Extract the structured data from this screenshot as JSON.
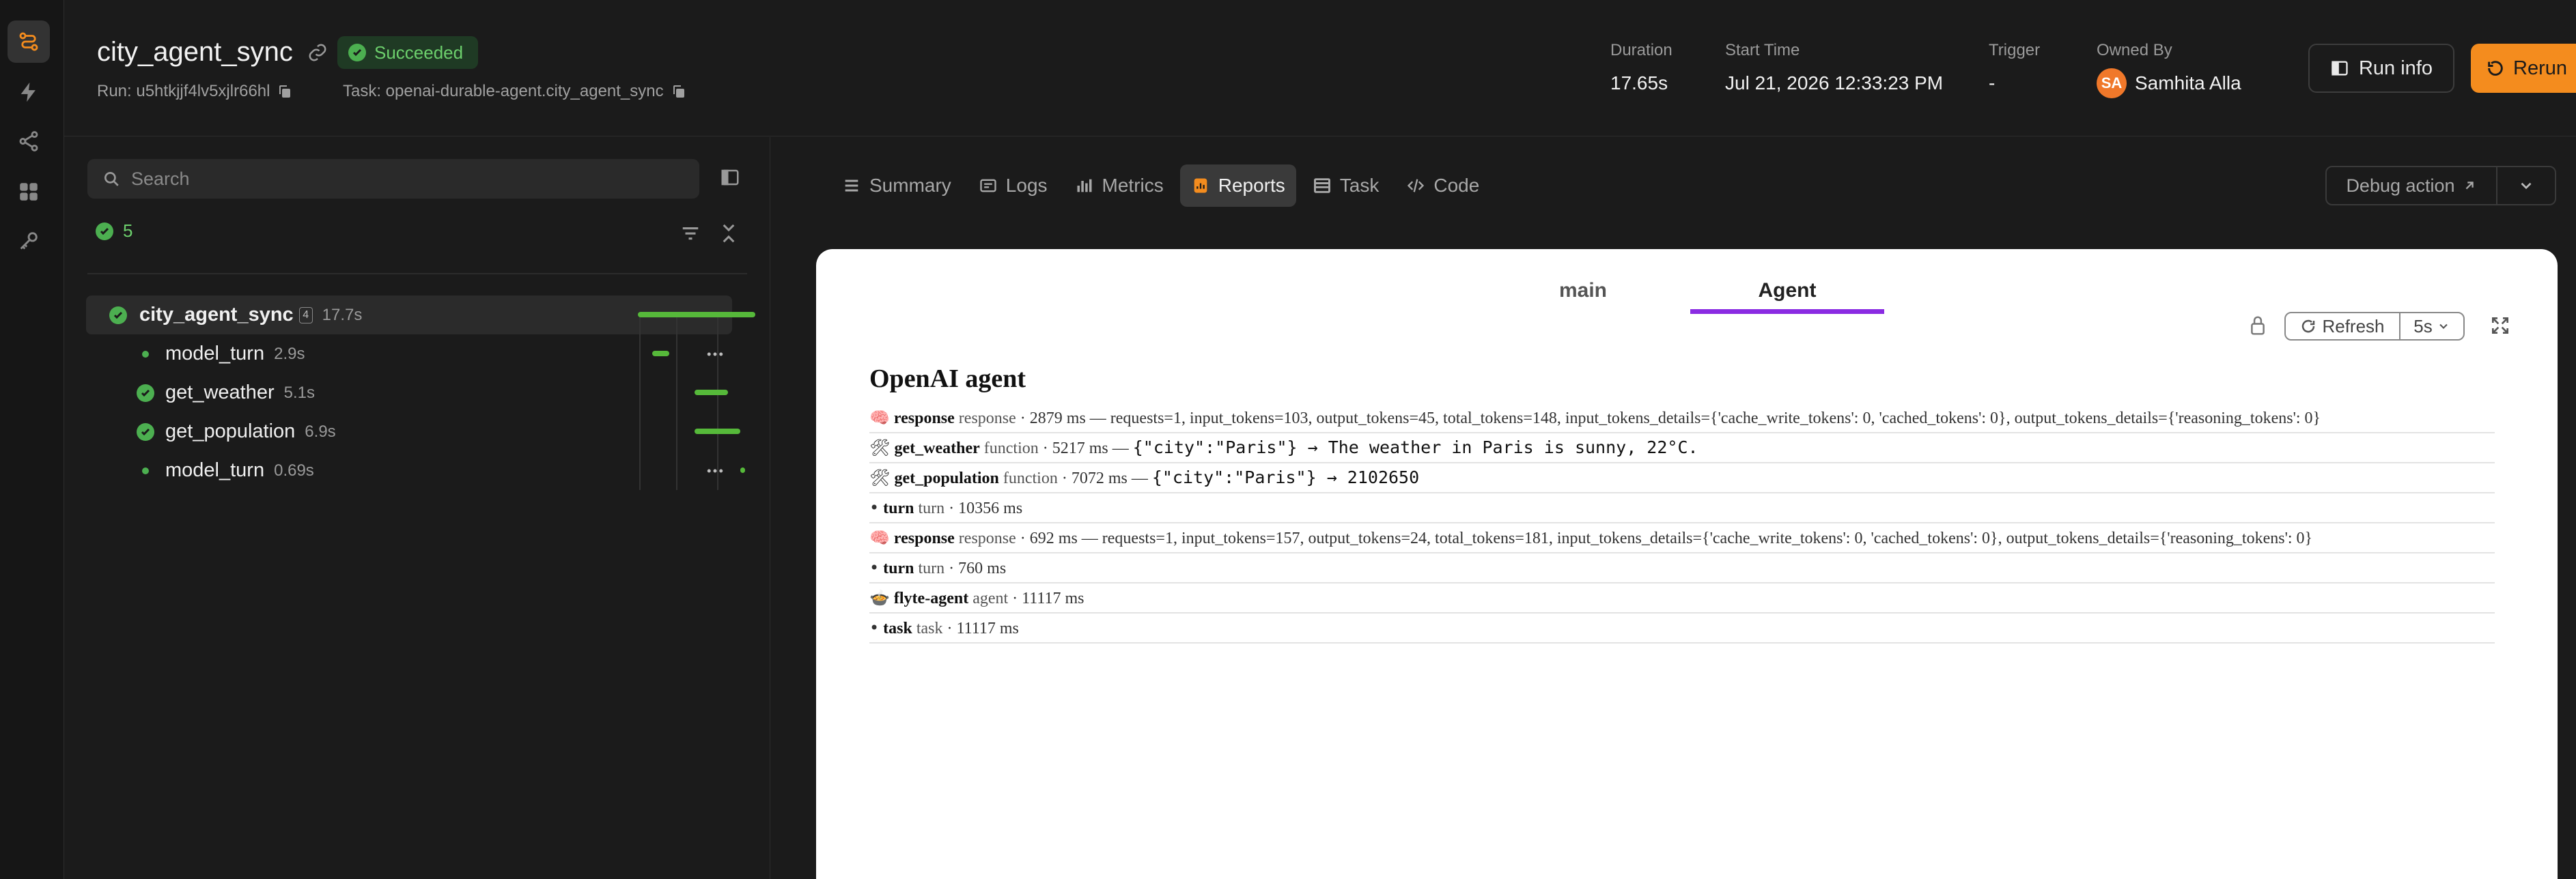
{
  "run": {
    "title": "city_agent_sync",
    "status": "Succeeded",
    "run_label": "Run: u5htkjjf4lv5xjlr66hl",
    "task_label": "Task: openai-durable-agent.city_agent_sync"
  },
  "meta": {
    "duration_label": "Duration",
    "duration_value": "17.65s",
    "start_label": "Start Time",
    "start_value": "Jul 21, 2026 12:33:23 PM",
    "trigger_label": "Trigger",
    "trigger_value": "-",
    "owner_label": "Owned By",
    "owner_initials": "SA",
    "owner_name": "Samhita Alla"
  },
  "header_buttons": {
    "run_info": "Run info",
    "rerun": "Rerun"
  },
  "left": {
    "search_placeholder": "Search",
    "success_count": "5",
    "tree": [
      {
        "name": "city_agent_sync",
        "badge": "4",
        "duration": "17.7s",
        "bar_start": 0.0,
        "bar_end": 1.0
      },
      {
        "name": "model_turn",
        "duration": "2.9s",
        "bar_start": 0.12,
        "bar_end": 0.27
      },
      {
        "name": "get_weather",
        "duration": "5.1s",
        "bar_start": 0.48,
        "bar_end": 0.77
      },
      {
        "name": "get_population",
        "duration": "6.9s",
        "bar_start": 0.48,
        "bar_end": 0.87
      },
      {
        "name": "model_turn",
        "duration": "0.69s",
        "bar_start": 0.87,
        "bar_end": 0.91
      }
    ]
  },
  "tabs": [
    {
      "label": "Summary",
      "icon": "summary-icon"
    },
    {
      "label": "Logs",
      "icon": "logs-icon"
    },
    {
      "label": "Metrics",
      "icon": "metrics-icon"
    },
    {
      "label": "Reports",
      "icon": "reports-icon"
    },
    {
      "label": "Task",
      "icon": "task-icon"
    },
    {
      "label": "Code",
      "icon": "code-icon"
    }
  ],
  "debug_action": "Debug action",
  "report": {
    "tabs": [
      "main",
      "Agent"
    ],
    "refresh": "Refresh",
    "interval": "5s",
    "title": "OpenAI agent",
    "lines": [
      {
        "emoji": "🧠",
        "name": "response",
        "kind": "response",
        "rest": " · 2879 ms — requests=1, input_tokens=103, output_tokens=45, total_tokens=148, input_tokens_details={'cache_write_tokens': 0, 'cached_tokens': 0}, output_tokens_details={'reasoning_tokens': 0}",
        "io": ""
      },
      {
        "emoji": "🛠",
        "name": "get_weather",
        "kind": "function",
        "rest": " · 5217 ms — ",
        "io": "{\"city\":\"Paris\"} → The weather in Paris is sunny, 22°C."
      },
      {
        "emoji": "🛠",
        "name": "get_population",
        "kind": "function",
        "rest": " · 7072 ms — ",
        "io": "{\"city\":\"Paris\"} → 2102650"
      },
      {
        "emoji": "•",
        "name": "turn",
        "kind": "turn",
        "rest": " · 10356 ms",
        "io": ""
      },
      {
        "emoji": "🧠",
        "name": "response",
        "kind": "response",
        "rest": " · 692 ms — requests=1, input_tokens=157, output_tokens=24, total_tokens=181, input_tokens_details={'cache_write_tokens': 0, 'cached_tokens': 0}, output_tokens_details={'reasoning_tokens': 0}",
        "io": ""
      },
      {
        "emoji": "•",
        "name": "turn",
        "kind": "turn",
        "rest": " · 760 ms",
        "io": ""
      },
      {
        "emoji": "🍲",
        "name": "flyte-agent",
        "kind": "agent",
        "rest": " · 11117 ms",
        "io": ""
      },
      {
        "emoji": "•",
        "name": "task",
        "kind": "task",
        "rest": " · 11117 ms",
        "io": ""
      }
    ]
  },
  "colors": {
    "accent": "#f48c1e",
    "success": "#4caf50",
    "tab_underline": "#8a2be2"
  }
}
